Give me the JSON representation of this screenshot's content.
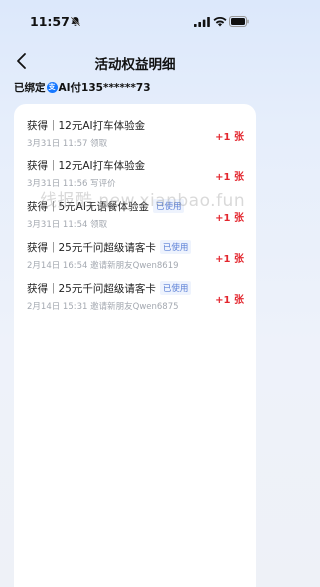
{
  "status_bar": {
    "time": "11:57"
  },
  "header": {
    "title": "活动权益明细"
  },
  "binding": {
    "prefix": "已绑定",
    "badge": "支",
    "account": "AI付135******73"
  },
  "records": [
    {
      "title": "获得｜12元AI打车体验金",
      "meta": "3月31日 11:57  领取",
      "tag": "",
      "count": "+1 张"
    },
    {
      "title": "获得｜12元AI打车体验金",
      "meta": "3月31日 11:56  写评价",
      "tag": "",
      "count": "+1 张"
    },
    {
      "title": "获得｜5元AI无语餐体验金",
      "meta": "3月31日 11:54  领取",
      "tag": "已使用",
      "count": "+1 张"
    },
    {
      "title": "获得｜25元千问超级请客卡",
      "meta": "2月14日 16:54  邀请新朋友Qwen8619",
      "tag": "已使用",
      "count": "+1 张"
    },
    {
      "title": "获得｜25元千问超级请客卡",
      "meta": "2月14日 15:31  邀请新朋友Qwen6875",
      "tag": "已使用",
      "count": "+1 张"
    }
  ],
  "watermark": "线报酷 new.xianbao.fun",
  "colors": {
    "accent": "#e3262e",
    "tag_text": "#5b7fd6",
    "alipay": "#1677ff"
  }
}
